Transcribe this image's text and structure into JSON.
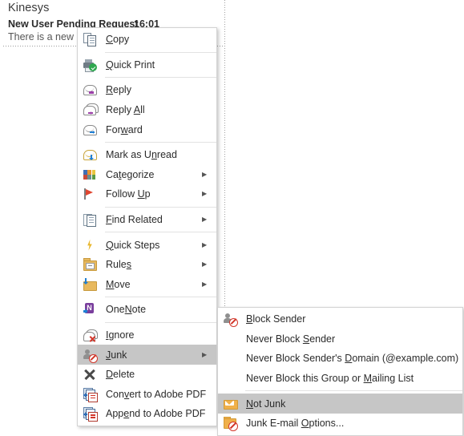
{
  "mail": {
    "sender": "Kinesys",
    "subject": "New User Pending Request",
    "time": "16:01",
    "preview": "There is a new u"
  },
  "context_menu": {
    "items": [
      {
        "label": "Copy",
        "mnemonic": "C",
        "icon": "copy-icon",
        "submenu": false,
        "highlighted": false,
        "sep_after": true
      },
      {
        "label": "Quick Print",
        "mnemonic": "Q",
        "icon": "quick-print-icon",
        "submenu": false,
        "highlighted": false,
        "sep_after": true
      },
      {
        "label": "Reply",
        "mnemonic": "R",
        "icon": "reply-icon",
        "submenu": false,
        "highlighted": false,
        "sep_after": false
      },
      {
        "label": "Reply All",
        "mnemonic": "A",
        "icon": "reply-all-icon",
        "submenu": false,
        "highlighted": false,
        "sep_after": false
      },
      {
        "label": "Forward",
        "mnemonic": "w",
        "icon": "forward-icon",
        "submenu": false,
        "highlighted": false,
        "sep_after": true
      },
      {
        "label": "Mark as Unread",
        "mnemonic": "n",
        "icon": "mark-unread-icon",
        "submenu": false,
        "highlighted": false,
        "sep_after": false
      },
      {
        "label": "Categorize",
        "mnemonic": "t",
        "icon": "categorize-icon",
        "submenu": true,
        "highlighted": false,
        "sep_after": false
      },
      {
        "label": "Follow Up",
        "mnemonic": "U",
        "icon": "follow-up-flag-icon",
        "submenu": true,
        "highlighted": false,
        "sep_after": true
      },
      {
        "label": "Find Related",
        "mnemonic": "F",
        "icon": "find-related-icon",
        "submenu": true,
        "highlighted": false,
        "sep_after": true
      },
      {
        "label": "Quick Steps",
        "mnemonic": "Q",
        "icon": "quick-steps-icon",
        "submenu": true,
        "highlighted": false,
        "sep_after": false
      },
      {
        "label": "Rules",
        "mnemonic": "s",
        "icon": "rules-icon",
        "submenu": true,
        "highlighted": false,
        "sep_after": false
      },
      {
        "label": "Move",
        "mnemonic": "M",
        "icon": "move-icon",
        "submenu": true,
        "highlighted": false,
        "sep_after": true
      },
      {
        "label": "OneNote",
        "mnemonic": "N",
        "icon": "onenote-icon",
        "submenu": false,
        "highlighted": false,
        "sep_after": true
      },
      {
        "label": "Ignore",
        "mnemonic": "I",
        "icon": "ignore-icon",
        "submenu": false,
        "highlighted": false,
        "sep_after": false
      },
      {
        "label": "Junk",
        "mnemonic": "J",
        "icon": "junk-icon",
        "submenu": true,
        "highlighted": true,
        "sep_after": false
      },
      {
        "label": "Delete",
        "mnemonic": "D",
        "icon": "delete-icon",
        "submenu": false,
        "highlighted": false,
        "sep_after": false
      },
      {
        "label": "Convert to Adobe PDF",
        "mnemonic": "v",
        "icon": "adobe-pdf-icon",
        "submenu": false,
        "highlighted": false,
        "sep_after": false
      },
      {
        "label": "Append to Adobe PDF",
        "mnemonic": "e",
        "icon": "adobe-pdf-icon",
        "submenu": false,
        "highlighted": false,
        "sep_after": false
      }
    ]
  },
  "junk_submenu": {
    "items": [
      {
        "label": "Block Sender",
        "mnemonic": "B",
        "icon": "block-sender-icon",
        "highlighted": false,
        "sep_after": false
      },
      {
        "label": "Never Block Sender",
        "mnemonic": "S",
        "icon": "none",
        "highlighted": false,
        "sep_after": false
      },
      {
        "label": "Never Block Sender's Domain (@example.com)",
        "mnemonic": "D",
        "icon": "none",
        "highlighted": false,
        "sep_after": false
      },
      {
        "label": "Never Block this Group or Mailing List",
        "mnemonic": "M",
        "icon": "none",
        "highlighted": false,
        "sep_after": true
      },
      {
        "label": "Not Junk",
        "mnemonic": "N",
        "icon": "not-junk-icon",
        "highlighted": true,
        "sep_after": false
      },
      {
        "label": "Junk E-mail Options...",
        "mnemonic": "O",
        "icon": "junk-options-icon",
        "highlighted": false,
        "sep_after": false
      }
    ]
  },
  "colors": {
    "highlight": "#c6c6c6",
    "menu_bg": "#ffffff",
    "menu_border": "#d3d3d3",
    "text": "#2b2b2b"
  }
}
